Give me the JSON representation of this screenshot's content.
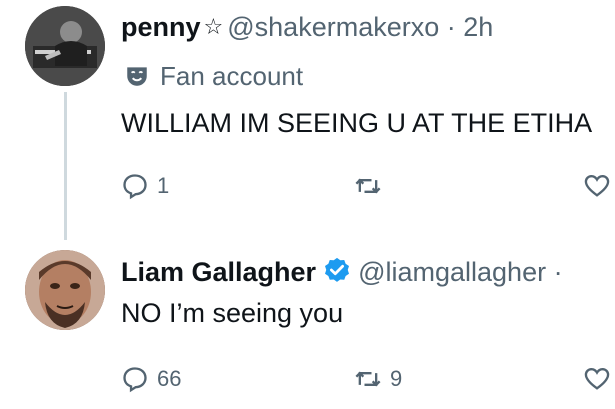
{
  "reply_tweet": {
    "display_name": "penny",
    "handle": "@shakermakerxo",
    "separator": "·",
    "time": "2h",
    "label": "Fan account",
    "text": "WILLIAM IM SEEING U AT THE ETIHA",
    "reply_count": "1",
    "retweet_count": "",
    "icons": {
      "avatar": "avatar",
      "name_badge": "star-icon",
      "label": "fan-account-icon",
      "reply": "reply-icon",
      "retweet": "retweet-icon",
      "like": "like-icon"
    }
  },
  "response_tweet": {
    "display_name": "Liam Gallagher",
    "handle": "@liamgallagher",
    "separator": "·",
    "text": "NO I’m seeing you",
    "reply_count": "66",
    "retweet_count": "9",
    "icons": {
      "avatar": "avatar",
      "badge": "verified-icon",
      "reply": "reply-icon",
      "retweet": "retweet-icon",
      "like": "like-icon"
    }
  },
  "colors": {
    "text_primary": "#0f1419",
    "text_secondary": "#536471",
    "verified_blue": "#1d9bf0",
    "thread_line": "#cfd9de"
  }
}
